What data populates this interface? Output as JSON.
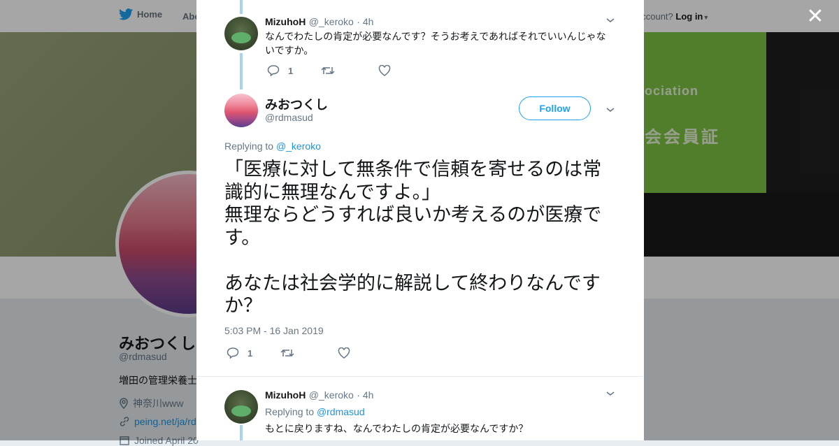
{
  "topbar": {
    "home_label": "Home",
    "about_label": "Abo",
    "account_prefix": "account?",
    "login_label": "Log in"
  },
  "banner": {
    "card_line1": "ociation",
    "card_line2": "会会員証"
  },
  "profile": {
    "name": "みおつくし",
    "handle": "@rdmasud",
    "bio": "増田の管理栄養士",
    "location": "神奈川www",
    "link": "peing.net/ja/rd",
    "joined": "Joined April 20"
  },
  "modal": {
    "tweet1": {
      "name": "MizuhoH",
      "handle": "@_keroko",
      "time": "· 4h",
      "text": "なんでわたしの肯定が必要なんです？そうお考えであればそれでいいんじゃないですか。",
      "reply_count": "1"
    },
    "main_tweet": {
      "name": "みおつくし",
      "handle": "@rdmasud",
      "follow_label": "Follow",
      "replying_prefix": "Replying to",
      "replying_to": "@_keroko",
      "text": "「医療に対して無条件で信頼を寄せるのは常識的に無理なんですよ。」\n無理ならどうすれば良いか考えるのが医療です。\n\nあなたは社会学的に解説して終わりなんですか？",
      "timestamp": "5:03 PM - 16 Jan 2019",
      "reply_count": "1"
    },
    "tweet3": {
      "name": "MizuhoH",
      "handle": "@_keroko",
      "time": "· 4h",
      "replying_prefix": "Replying to",
      "replying_to": "@rdmasud",
      "text": "もとに戻りますね、なんでわたしの肯定が必要なんですか？"
    }
  },
  "icons": {
    "reply": "reply-icon",
    "retweet": "retweet-icon",
    "like": "heart-icon",
    "chevron": "chevron-down-icon",
    "close": "close-icon",
    "twitter": "twitter-bird-icon"
  },
  "colors": {
    "accent": "#1da1f2",
    "thread_line": "#a8d2f0",
    "text_primary": "#14171a",
    "text_secondary": "#657786"
  }
}
